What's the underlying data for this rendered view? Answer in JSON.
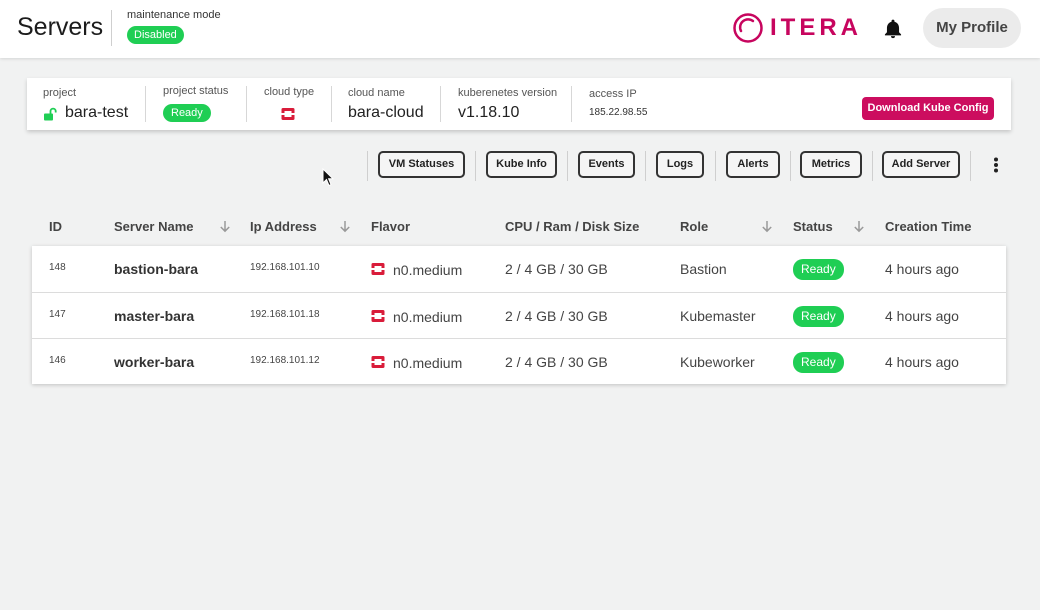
{
  "header": {
    "title": "Servers",
    "maintenance_label": "maintenance mode",
    "maintenance_status": "Disabled",
    "brand_name": "ITERA",
    "brand_color": "#c7055e",
    "profile_label": "My Profile"
  },
  "project": {
    "project_label": "project",
    "project_name": "bara-test",
    "status_label": "project status",
    "status_value": "Ready",
    "cloud_type_label": "cloud type",
    "cloud_type_icon": "openstack-icon",
    "cloud_name_label": "cloud name",
    "cloud_name": "bara-cloud",
    "k8s_label": "kuberenetes version",
    "k8s_version": "v1.18.10",
    "access_ip_label": "access IP",
    "access_ip": "185.22.98.55",
    "download_label": "Download Kube Config"
  },
  "toolbar": {
    "buttons": [
      "VM Statuses",
      "Kube Info",
      "Events",
      "Logs",
      "Alerts",
      "Metrics",
      "Add Server"
    ]
  },
  "table": {
    "columns": [
      "ID",
      "Server Name",
      "Ip Address",
      "Flavor",
      "CPU / Ram / Disk Size",
      "Role",
      "Status",
      "Creation Time"
    ],
    "rows": [
      {
        "id": "148",
        "name": "bastion-bara",
        "ip": "192.168.101.10",
        "flavor": "n0.medium",
        "spec": "2 / 4 GB / 30 GB",
        "role": "Bastion",
        "status": "Ready",
        "created": "4 hours ago"
      },
      {
        "id": "147",
        "name": "master-bara",
        "ip": "192.168.101.18",
        "flavor": "n0.medium",
        "spec": "2 / 4 GB / 30 GB",
        "role": "Kubemaster",
        "status": "Ready",
        "created": "4 hours ago"
      },
      {
        "id": "146",
        "name": "worker-bara",
        "ip": "192.168.101.12",
        "flavor": "n0.medium",
        "spec": "2 / 4 GB / 30 GB",
        "role": "Kubeworker",
        "status": "Ready",
        "created": "4 hours ago"
      }
    ]
  },
  "colors": {
    "ready_green": "#1fce54",
    "accent_magenta": "#cc0d5f",
    "cloud_red": "#d91c3a"
  }
}
